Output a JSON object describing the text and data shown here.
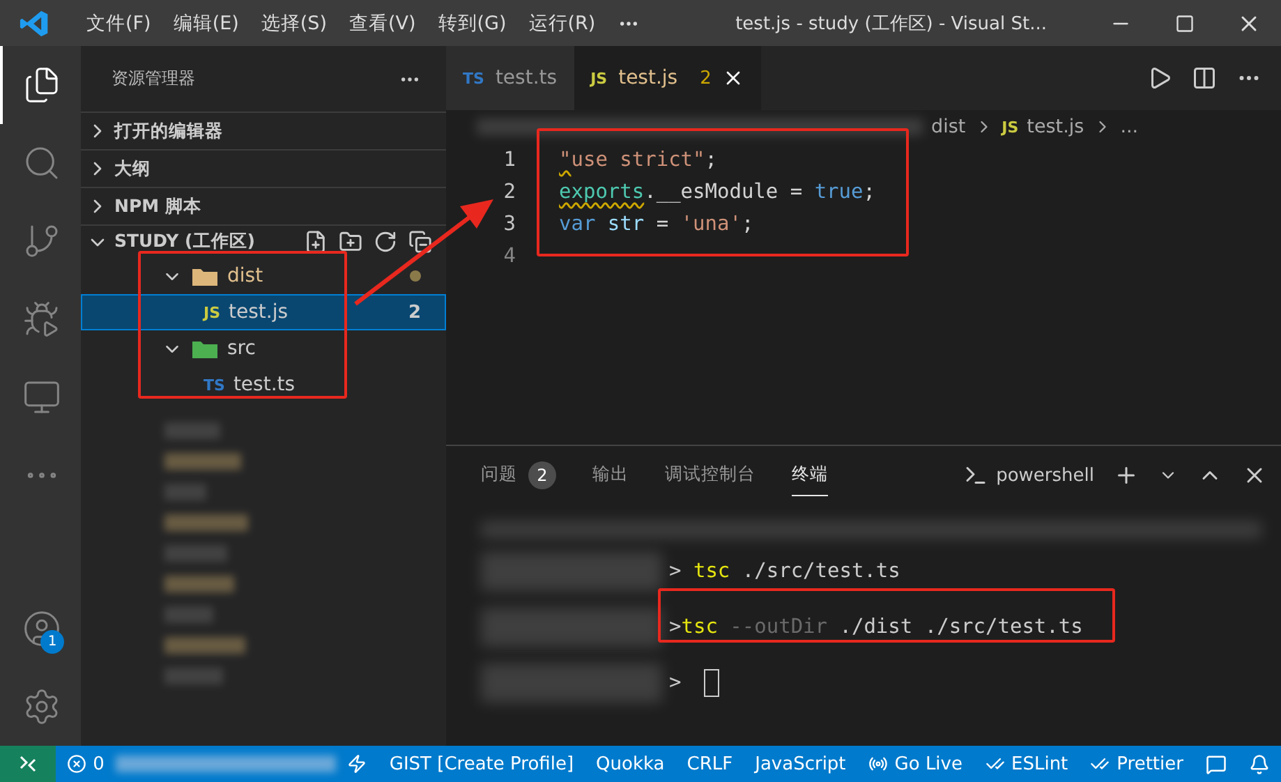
{
  "title_bar": {
    "menus": [
      "文件(F)",
      "编辑(E)",
      "选择(S)",
      "查看(V)",
      "转到(G)",
      "运行(R)"
    ],
    "title": "test.js - study (工作区) - Visual St..."
  },
  "activity_bar": [
    {
      "kind": "files",
      "selected": true
    },
    {
      "kind": "search",
      "selected": false
    },
    {
      "kind": "source-control",
      "selected": false
    },
    {
      "kind": "debug",
      "selected": false
    },
    {
      "kind": "remote",
      "selected": false
    },
    {
      "kind": "more",
      "selected": false
    },
    {
      "kind": "account",
      "selected": false,
      "badge": "1"
    },
    {
      "kind": "settings",
      "selected": false
    }
  ],
  "sidebar": {
    "title": "资源管理器",
    "sections": [
      {
        "label": "打开的编辑器",
        "expanded": false
      },
      {
        "label": "大纲",
        "expanded": false
      },
      {
        "label": "NPM 脚本",
        "expanded": false
      }
    ],
    "workspace": {
      "label": "STUDY (工作区)",
      "expanded": true
    },
    "tree": [
      {
        "name": "dist",
        "kind": "folder",
        "color": "#dcb67a",
        "modified": true,
        "expanded": true,
        "children": [
          {
            "name": "test.js",
            "kind": "file",
            "icon": "JS",
            "selected": true,
            "badge": "2"
          }
        ]
      },
      {
        "name": "src",
        "kind": "folder",
        "color": "#4caf50",
        "modified": false,
        "expanded": true,
        "children": [
          {
            "name": "test.ts",
            "kind": "file",
            "icon": "TS",
            "selected": false
          }
        ]
      }
    ]
  },
  "tabs": [
    {
      "label": "test.ts",
      "icon": "TS",
      "selected": false
    },
    {
      "label": "test.js",
      "icon": "JS",
      "selected": true,
      "badge": "2"
    }
  ],
  "breadcrumb": [
    {
      "label": "dist"
    },
    {
      "label": "test.js",
      "icon": "JS"
    },
    {
      "label": "..."
    }
  ],
  "code": [
    {
      "number": "1",
      "tokens": [
        {
          "text": "\"",
          "kind": "string",
          "warning": true
        },
        {
          "text": "use strict\"",
          "kind": "string"
        },
        {
          "text": ";",
          "kind": "plain"
        }
      ]
    },
    {
      "number": "2",
      "tokens": [
        {
          "text": "exports",
          "kind": "type",
          "warning": true
        },
        {
          "text": ".__esModule = ",
          "kind": "plain"
        },
        {
          "text": "true",
          "kind": "keyword"
        },
        {
          "text": ";",
          "kind": "plain"
        }
      ]
    },
    {
      "number": "3",
      "tokens": [
        {
          "text": "var",
          "kind": "keyword"
        },
        {
          "text": " str",
          "kind": "variable"
        },
        {
          "text": " = ",
          "kind": "plain"
        },
        {
          "text": "'una'",
          "kind": "string"
        },
        {
          "text": ";",
          "kind": "plain"
        }
      ]
    },
    {
      "number": "4"
    }
  ],
  "panel": {
    "tabs": [
      {
        "label": "问题",
        "selected": false,
        "badge": "2"
      },
      {
        "label": "输出",
        "selected": false
      },
      {
        "label": "调试控制台",
        "selected": false
      },
      {
        "label": "终端",
        "selected": true
      }
    ],
    "shell": "powershell",
    "lines": [
      {
        "prompt": "> ",
        "tokens": [
          {
            "text": "tsc",
            "kind": "command"
          },
          {
            "text": " ./src/test.ts",
            "kind": "arg"
          }
        ]
      },
      {
        "prompt": ">",
        "tokens": [
          {
            "text": "tsc",
            "kind": "command"
          },
          {
            "text": " --outDir",
            "kind": "option"
          },
          {
            "text": " ./dist ./src/test.ts",
            "kind": "arg"
          }
        ]
      },
      {
        "prompt": "> ",
        "cursor": true
      }
    ]
  },
  "status_bar": [
    {
      "kind": "errors",
      "text": "0"
    },
    {
      "kind": "zap"
    },
    {
      "kind": "text",
      "text": "GIST [Create Profile]"
    },
    {
      "kind": "text",
      "text": "Quokka"
    },
    {
      "kind": "text",
      "text": "CRLF"
    },
    {
      "kind": "text",
      "text": "JavaScript"
    },
    {
      "kind": "golive",
      "text": "Go Live"
    },
    {
      "kind": "check",
      "text": "ESLint"
    },
    {
      "kind": "check",
      "text": "Prettier"
    },
    {
      "kind": "feedback"
    },
    {
      "kind": "bell"
    }
  ]
}
